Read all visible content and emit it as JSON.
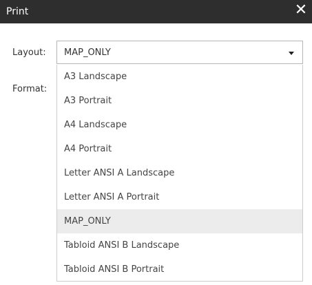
{
  "dialog": {
    "title": "Print",
    "close_glyph": "✕"
  },
  "form": {
    "layout_label": "Layout:",
    "format_label": "Format:",
    "layout_selected": "MAP_ONLY",
    "layout_options": [
      "A3 Landscape",
      "A3 Portrait",
      "A4 Landscape",
      "A4 Portrait",
      "Letter ANSI A Landscape",
      "Letter ANSI A Portrait",
      "MAP_ONLY",
      "Tabloid ANSI B Landscape",
      "Tabloid ANSI B Portrait"
    ],
    "highlighted_option_index": 6
  },
  "icons": {
    "close": "close-icon",
    "dropdown": "chevron-down-icon"
  },
  "colors": {
    "titlebar": "#2e2e2e",
    "highlight": "#ececec"
  }
}
